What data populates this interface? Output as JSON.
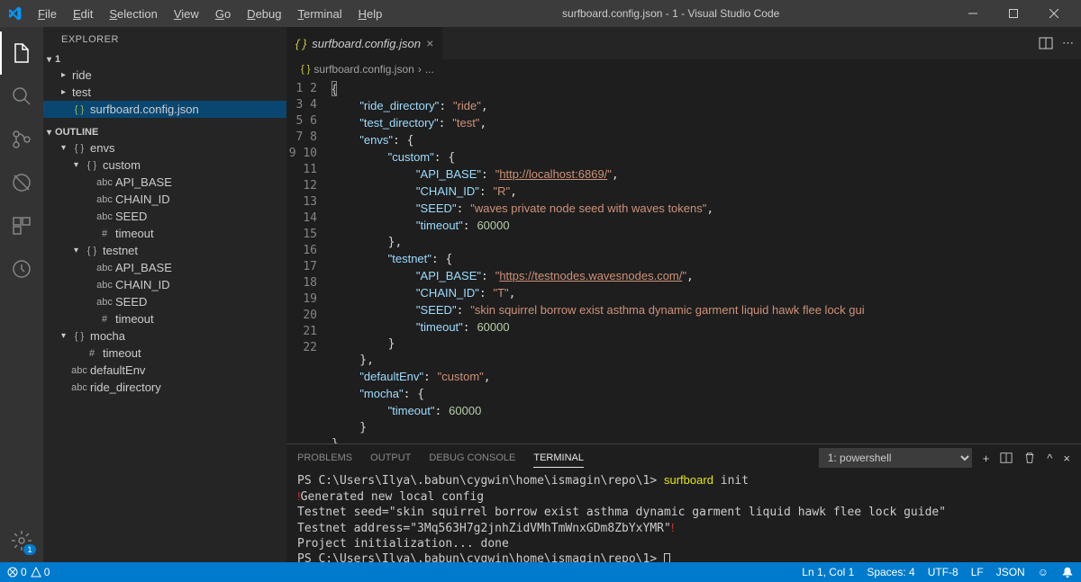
{
  "titlebar": {
    "title": "surfboard.config.json - 1 - Visual Studio Code",
    "menu": [
      "File",
      "Edit",
      "Selection",
      "View",
      "Go",
      "Debug",
      "Terminal",
      "Help"
    ]
  },
  "sidebar": {
    "title": "EXPLORER",
    "folder": "1",
    "tree": [
      {
        "type": "folder",
        "label": "ride"
      },
      {
        "type": "folder",
        "label": "test"
      },
      {
        "type": "file",
        "label": "surfboard.config.json",
        "selected": true
      }
    ],
    "outline": {
      "title": "OUTLINE",
      "items": [
        {
          "indent": 0,
          "type": "obj",
          "label": "envs",
          "expanded": true
        },
        {
          "indent": 1,
          "type": "obj",
          "label": "custom",
          "expanded": true
        },
        {
          "indent": 2,
          "type": "abc",
          "label": "API_BASE"
        },
        {
          "indent": 2,
          "type": "abc",
          "label": "CHAIN_ID"
        },
        {
          "indent": 2,
          "type": "abc",
          "label": "SEED"
        },
        {
          "indent": 2,
          "type": "num",
          "label": "timeout"
        },
        {
          "indent": 1,
          "type": "obj",
          "label": "testnet",
          "expanded": true
        },
        {
          "indent": 2,
          "type": "abc",
          "label": "API_BASE"
        },
        {
          "indent": 2,
          "type": "abc",
          "label": "CHAIN_ID"
        },
        {
          "indent": 2,
          "type": "abc",
          "label": "SEED"
        },
        {
          "indent": 2,
          "type": "num",
          "label": "timeout"
        },
        {
          "indent": 0,
          "type": "obj",
          "label": "mocha",
          "expanded": true
        },
        {
          "indent": 1,
          "type": "num",
          "label": "timeout"
        },
        {
          "indent": 0,
          "type": "abc",
          "label": "defaultEnv"
        },
        {
          "indent": 0,
          "type": "abc",
          "label": "ride_directory"
        }
      ]
    }
  },
  "editor": {
    "tab": "surfboard.config.json",
    "breadcrumb": [
      "surfboard.config.json",
      "..."
    ],
    "config": {
      "ride_directory": "ride",
      "test_directory": "test",
      "envs": {
        "custom": {
          "API_BASE": "http://localhost:6869/",
          "CHAIN_ID": "R",
          "SEED": "waves private node seed with waves tokens",
          "timeout": 60000
        },
        "testnet": {
          "API_BASE": "https://testnodes.wavesnodes.com/",
          "CHAIN_ID": "T",
          "SEED": "skin squirrel borrow exist asthma dynamic garment liquid hawk flee lock gui",
          "timeout": 60000
        }
      },
      "defaultEnv": "custom",
      "mocha": {
        "timeout": 60000
      }
    }
  },
  "panel": {
    "tabs": [
      "PROBLEMS",
      "OUTPUT",
      "DEBUG CONSOLE",
      "TERMINAL"
    ],
    "active": "TERMINAL",
    "select": "1: powershell",
    "terminal": {
      "prompt": "PS C:\\Users\\Ilya\\.babun\\cygwin\\home\\ismagin\\repo\\1>",
      "cmd": "surfboard",
      "cmd_arg": " init",
      "l2": "Generated new local config",
      "l3": "Testnet seed=\"skin squirrel borrow exist asthma dynamic garment liquid hawk flee lock guide\"",
      "l4": "Testnet address=\"3Mq563H7g2jnhZidVMhTmWnxGDm8ZbYxYMR\"",
      "l5": "Project initialization... done"
    }
  },
  "statusbar": {
    "errors": "0",
    "warnings": "0",
    "ln_col": "Ln 1, Col 1",
    "spaces": "Spaces: 4",
    "encoding": "UTF-8",
    "eol": "LF",
    "lang": "JSON"
  },
  "badge_settings": "1"
}
